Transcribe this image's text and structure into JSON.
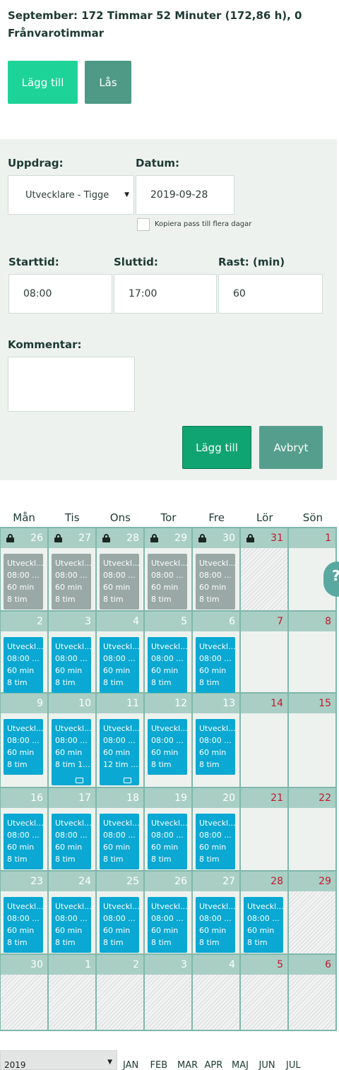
{
  "summary": "September: 172 Timmar 52 Minuter (172,86 h), 0 Frånvarotimmar",
  "top_buttons": {
    "add": "Lägg till",
    "lock": "Lås"
  },
  "form": {
    "assignment_label": "Uppdrag:",
    "assignment_value": "Utvecklare - Tigge",
    "date_label": "Datum:",
    "date_value": "2019-09-28",
    "copy_label": "Kopiera pass till flera dagar",
    "start_label": "Starttid:",
    "start_value": "08:00",
    "end_label": "Sluttid:",
    "end_value": "17:00",
    "break_label": "Rast: (min)",
    "break_value": "60",
    "comment_label": "Kommentar:",
    "add_button": "Lägg till",
    "cancel_button": "Avbryt"
  },
  "weekdays": [
    "Mån",
    "Tis",
    "Ons",
    "Tor",
    "Fre",
    "Lör",
    "Sön"
  ],
  "weeks": [
    [
      {
        "day": "26",
        "locked": true,
        "shift": [
          "Utveckl...",
          "08:00 ...",
          "60 min",
          "8 tim"
        ],
        "state": "grey"
      },
      {
        "day": "27",
        "locked": true,
        "shift": [
          "Utveckl...",
          "08:00 ...",
          "60 min",
          "8 tim"
        ],
        "state": "grey"
      },
      {
        "day": "28",
        "locked": true,
        "shift": [
          "Utveckl...",
          "08:00 ...",
          "60 min",
          "8 tim"
        ],
        "state": "grey"
      },
      {
        "day": "29",
        "locked": true,
        "shift": [
          "Utveckl...",
          "08:00 ...",
          "60 min",
          "8 tim"
        ],
        "state": "grey"
      },
      {
        "day": "30",
        "locked": true,
        "shift": [
          "Utveckl...",
          "08:00 ...",
          "60 min",
          "8 tim"
        ],
        "state": "grey"
      },
      {
        "day": "31",
        "locked": true,
        "red": true,
        "hatched": true
      },
      {
        "day": "1",
        "red": true
      }
    ],
    [
      {
        "day": "2",
        "shift": [
          "Utveckl...",
          "08:00 ...",
          "60 min",
          "8 tim"
        ],
        "state": "blue"
      },
      {
        "day": "3",
        "shift": [
          "Utveckl...",
          "08:00 ...",
          "60 min",
          "8 tim"
        ],
        "state": "blue"
      },
      {
        "day": "4",
        "shift": [
          "Utveckl...",
          "08:00 ...",
          "60 min",
          "8 tim"
        ],
        "state": "blue"
      },
      {
        "day": "5",
        "shift": [
          "Utveckl...",
          "08:00 ...",
          "60 min",
          "8 tim"
        ],
        "state": "blue"
      },
      {
        "day": "6",
        "shift": [
          "Utveckl...",
          "08:00 ...",
          "60 min",
          "8 tim"
        ],
        "state": "blue"
      },
      {
        "day": "7",
        "red": true
      },
      {
        "day": "8",
        "red": true
      }
    ],
    [
      {
        "day": "9",
        "shift": [
          "Utveckl...",
          "08:00 ...",
          "60 min",
          "8 tim"
        ],
        "state": "blue"
      },
      {
        "day": "10",
        "shift": [
          "Utveckl...",
          "08:00 ...",
          "60 min",
          "8 tim 1..."
        ],
        "state": "blue",
        "comment": true
      },
      {
        "day": "11",
        "shift": [
          "Utveckl...",
          "08:00 ...",
          "60 min",
          "12 tim ..."
        ],
        "state": "blue",
        "comment": true
      },
      {
        "day": "12",
        "shift": [
          "Utveckl...",
          "08:00 ...",
          "60 min",
          "8 tim"
        ],
        "state": "blue"
      },
      {
        "day": "13",
        "shift": [
          "Utveckl...",
          "08:00 ...",
          "60 min",
          "8 tim"
        ],
        "state": "blue"
      },
      {
        "day": "14",
        "red": true
      },
      {
        "day": "15",
        "red": true
      }
    ],
    [
      {
        "day": "16",
        "shift": [
          "Utveckl...",
          "08:00 ...",
          "60 min",
          "8 tim"
        ],
        "state": "blue"
      },
      {
        "day": "17",
        "shift": [
          "Utveckl...",
          "08:00 ...",
          "60 min",
          "8 tim"
        ],
        "state": "blue"
      },
      {
        "day": "18",
        "shift": [
          "Utveckl...",
          "08:00 ...",
          "60 min",
          "8 tim"
        ],
        "state": "blue"
      },
      {
        "day": "19",
        "shift": [
          "Utveckl...",
          "08:00 ...",
          "60 min",
          "8 tim"
        ],
        "state": "blue"
      },
      {
        "day": "20",
        "shift": [
          "Utveckl...",
          "08:00 ...",
          "60 min",
          "8 tim"
        ],
        "state": "blue"
      },
      {
        "day": "21",
        "red": true
      },
      {
        "day": "22",
        "red": true
      }
    ],
    [
      {
        "day": "23",
        "shift": [
          "Utveckl...",
          "08:00 ...",
          "60 min",
          "8 tim"
        ],
        "state": "blue"
      },
      {
        "day": "24",
        "shift": [
          "Utveckl...",
          "08:00 ...",
          "60 min",
          "8 tim"
        ],
        "state": "blue"
      },
      {
        "day": "25",
        "shift": [
          "Utveckl...",
          "08:00 ...",
          "60 min",
          "8 tim"
        ],
        "state": "blue"
      },
      {
        "day": "26",
        "shift": [
          "Utveckl...",
          "08:00 ...",
          "60 min",
          "8 tim"
        ],
        "state": "blue"
      },
      {
        "day": "27",
        "shift": [
          "Utveckl...",
          "08:00 ...",
          "60 min",
          "8 tim"
        ],
        "state": "blue"
      },
      {
        "day": "28",
        "red": true,
        "shift": [
          "Utveckl...",
          "08:00 ...",
          "60 min",
          "8 tim"
        ],
        "state": "blue"
      },
      {
        "day": "29",
        "red": true,
        "hatched": true
      }
    ],
    [
      {
        "day": "30",
        "hatched": true
      },
      {
        "day": "1",
        "hatched": true
      },
      {
        "day": "2",
        "hatched": true
      },
      {
        "day": "3",
        "hatched": true
      },
      {
        "day": "4",
        "hatched": true
      },
      {
        "day": "5",
        "red": true,
        "hatched": true
      },
      {
        "day": "6",
        "red": true,
        "hatched": true
      }
    ]
  ],
  "help_tab": "?",
  "year_select": "2019",
  "months": [
    "JAN",
    "FEB",
    "MAR",
    "APR",
    "MAJ",
    "JUN",
    "JUL"
  ]
}
